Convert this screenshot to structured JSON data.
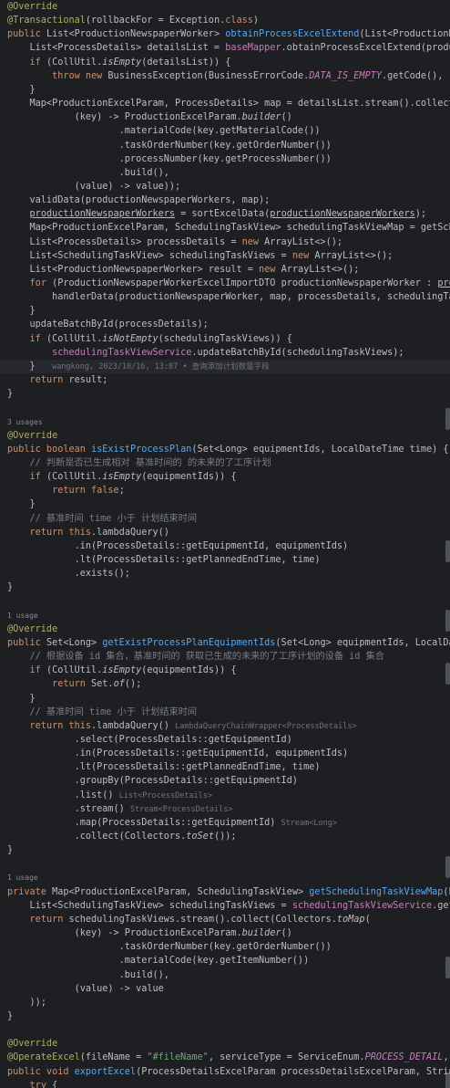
{
  "theme": {
    "background": "#1e1f22",
    "current_line": "#26282e",
    "colors": {
      "t": "#bcbec4",
      "k": "#cf8e6d",
      "a": "#b3ae60",
      "f": "#56a8f5",
      "s": "#6aab73",
      "c": "#7a7e85",
      "i": "#c77dbb",
      "h": "#6f737a",
      "u": "#868a91",
      "fy": "#56a8f5"
    }
  },
  "lines": [
    {
      "small": false,
      "tokens": [
        [
          "a",
          "@Override"
        ]
      ]
    },
    {
      "small": false,
      "tokens": [
        [
          "a",
          "@Transactional"
        ],
        [
          "t",
          "(rollbackFor = Exception."
        ],
        [
          "k",
          "class"
        ],
        [
          "t",
          ")"
        ]
      ]
    },
    {
      "small": false,
      "tokens": [
        [
          "k",
          "public "
        ],
        [
          "t",
          "List<ProductionNewspaperWorker> "
        ],
        [
          "fy",
          "obtainProcessExcelExtend"
        ],
        [
          "t",
          "(List<ProductionNewspaperWorke"
        ]
      ]
    },
    {
      "small": false,
      "tokens": [
        [
          "t",
          "    List<ProcessDetails> detailsList = "
        ],
        [
          "i",
          "baseMapper"
        ],
        [
          "t",
          ".obtainProcessExcelExtend(productionNewspape"
        ]
      ]
    },
    {
      "small": false,
      "tokens": [
        [
          "t",
          "    "
        ],
        [
          "k",
          "if "
        ],
        [
          "t",
          "(CollUtil."
        ],
        [
          "it",
          "isEmpty"
        ],
        [
          "t",
          "(detailsList)) {"
        ]
      ]
    },
    {
      "small": false,
      "tokens": [
        [
          "t",
          "        "
        ],
        [
          "k",
          "throw new "
        ],
        [
          "t",
          "BusinessException(BusinessErrorCode."
        ],
        [
          "ip",
          "DATA_IS_EMPTY"
        ],
        [
          "t",
          ".getCode(), "
        ],
        [
          "s",
          "\"导入的报工数据查"
        ]
      ]
    },
    {
      "small": false,
      "tokens": [
        [
          "t",
          "    }"
        ]
      ]
    },
    {
      "small": false,
      "tokens": [
        [
          "t",
          "    Map<ProductionExcelParam, ProcessDetails> map = detailsList.stream().collect(Collectors."
        ]
      ]
    },
    {
      "small": false,
      "tokens": [
        [
          "t",
          "            (key) -> ProductionExcelParam."
        ],
        [
          "it",
          "builder"
        ],
        [
          "t",
          "()"
        ]
      ]
    },
    {
      "small": false,
      "tokens": [
        [
          "t",
          "                    .materialCode(key.getMaterialCode())"
        ]
      ]
    },
    {
      "small": false,
      "tokens": [
        [
          "t",
          "                    .taskOrderNumber(key.getOrderNumber())"
        ]
      ]
    },
    {
      "small": false,
      "tokens": [
        [
          "t",
          "                    .processNumber(key.getProcessNumber())"
        ]
      ]
    },
    {
      "small": false,
      "tokens": [
        [
          "t",
          "                    .build(),"
        ]
      ]
    },
    {
      "small": false,
      "tokens": [
        [
          "t",
          "            (value) -> value));"
        ]
      ]
    },
    {
      "small": false,
      "tokens": [
        [
          "t",
          "    validData(productionNewspaperWorkers, map);"
        ]
      ]
    },
    {
      "small": false,
      "tokens": [
        [
          "t",
          "    "
        ],
        [
          "tu",
          "productionNewspaperWorkers"
        ],
        [
          "t",
          " = sortExcelData("
        ],
        [
          "tu",
          "productionNewspaperWorkers"
        ],
        [
          "t",
          ");"
        ]
      ]
    },
    {
      "small": false,
      "tokens": [
        [
          "t",
          "    Map<ProductionExcelParam, SchedulingTaskView> schedulingTaskViewMap = getSchedulingTaskVi"
        ]
      ]
    },
    {
      "small": false,
      "tokens": [
        [
          "t",
          "    List<ProcessDetails> processDetails = "
        ],
        [
          "k",
          "new "
        ],
        [
          "t",
          "ArrayList<>();"
        ]
      ]
    },
    {
      "small": false,
      "tokens": [
        [
          "t",
          "    List<SchedulingTaskView> schedulingTaskViews = "
        ],
        [
          "k",
          "new "
        ],
        [
          "t",
          "ArrayList<>();"
        ]
      ]
    },
    {
      "small": false,
      "tokens": [
        [
          "t",
          "    List<ProductionNewspaperWorker> result = "
        ],
        [
          "k",
          "new "
        ],
        [
          "t",
          "ArrayList<>();"
        ]
      ]
    },
    {
      "small": false,
      "tokens": [
        [
          "t",
          "    "
        ],
        [
          "k",
          "for "
        ],
        [
          "t",
          "(ProductionNewspaperWorkerExcelImportDTO productionNewspaperWorker : "
        ],
        [
          "tu",
          "productionNewspa"
        ]
      ]
    },
    {
      "small": false,
      "tokens": [
        [
          "t",
          "        handlerData(productionNewspaperWorker, map, processDetails, schedulingTaskViewMap, sc"
        ]
      ]
    },
    {
      "small": false,
      "tokens": [
        [
          "t",
          "    }"
        ]
      ]
    },
    {
      "small": false,
      "tokens": [
        [
          "t",
          "    updateBatchById(processDetails);"
        ]
      ]
    },
    {
      "small": false,
      "tokens": [
        [
          "t",
          "    "
        ],
        [
          "k",
          "if "
        ],
        [
          "t",
          "(CollUtil."
        ],
        [
          "it",
          "isNotEmpty"
        ],
        [
          "t",
          "(schedulingTaskViews)) {"
        ]
      ]
    },
    {
      "small": false,
      "tokens": [
        [
          "t",
          "        "
        ],
        [
          "i",
          "schedulingTaskViewService"
        ],
        [
          "t",
          ".updateBatchById(schedulingTaskViews);"
        ]
      ]
    },
    {
      "small": false,
      "hl": true,
      "tokens": [
        [
          "t",
          "    }   "
        ],
        [
          "h",
          "wangkong, 2023/10/16, 13:07 • 查询添加计划数量字段"
        ]
      ]
    },
    {
      "small": false,
      "tokens": [
        [
          "t",
          "    "
        ],
        [
          "k",
          "return "
        ],
        [
          "t",
          "result;"
        ]
      ]
    },
    {
      "small": false,
      "tokens": [
        [
          "t",
          "}"
        ]
      ]
    },
    {
      "small": false,
      "tokens": []
    },
    {
      "small": true,
      "tokens": [
        [
          "u",
          "3 usages"
        ]
      ]
    },
    {
      "small": false,
      "tokens": [
        [
          "a",
          "@Override"
        ]
      ]
    },
    {
      "small": false,
      "tokens": [
        [
          "k",
          "public boolean "
        ],
        [
          "fy",
          "isExistProcessPlan"
        ],
        [
          "t",
          "(Set<Long> equipmentIds, LocalDateTime time) {"
        ]
      ]
    },
    {
      "small": false,
      "tokens": [
        [
          "c",
          "    // 判断是否已生成相对 基准时间的 的未来的了工序计划"
        ]
      ]
    },
    {
      "small": false,
      "tokens": [
        [
          "t",
          "    "
        ],
        [
          "k",
          "if "
        ],
        [
          "t",
          "(CollUtil."
        ],
        [
          "it",
          "isEmpty"
        ],
        [
          "t",
          "(equipmentIds)) {"
        ]
      ]
    },
    {
      "small": false,
      "tokens": [
        [
          "t",
          "        "
        ],
        [
          "k",
          "return false"
        ],
        [
          "t",
          ";"
        ]
      ]
    },
    {
      "small": false,
      "tokens": [
        [
          "t",
          "    }"
        ]
      ]
    },
    {
      "small": false,
      "tokens": [
        [
          "c",
          "    // 基准时间 time 小于 计划结束时间"
        ]
      ]
    },
    {
      "small": false,
      "tokens": [
        [
          "t",
          "    "
        ],
        [
          "k",
          "return this"
        ],
        [
          "t",
          ".lambdaQuery()"
        ]
      ]
    },
    {
      "small": false,
      "tokens": [
        [
          "t",
          "            .in(ProcessDetails::getEquipmentId, equipmentIds)"
        ]
      ]
    },
    {
      "small": false,
      "tokens": [
        [
          "t",
          "            .lt(ProcessDetails::getPlannedEndTime, time)"
        ]
      ]
    },
    {
      "small": false,
      "tokens": [
        [
          "t",
          "            .exists();"
        ]
      ]
    },
    {
      "small": false,
      "tokens": [
        [
          "t",
          "}"
        ]
      ]
    },
    {
      "small": false,
      "tokens": []
    },
    {
      "small": true,
      "tokens": [
        [
          "u",
          "1 usage"
        ]
      ]
    },
    {
      "small": false,
      "tokens": [
        [
          "a",
          "@Override"
        ]
      ]
    },
    {
      "small": false,
      "tokens": [
        [
          "k",
          "public "
        ],
        [
          "t",
          "Set<Long> "
        ],
        [
          "fy",
          "getExistProcessPlanEquipmentIds"
        ],
        [
          "t",
          "(Set<Long> equipmentIds, LocalDateTime time)"
        ]
      ]
    },
    {
      "small": false,
      "tokens": [
        [
          "c",
          "    // 根据设备 id 集合，基准时间的 获取已生成的未来的了工序计划的设备 id 集合"
        ]
      ]
    },
    {
      "small": false,
      "tokens": [
        [
          "t",
          "    "
        ],
        [
          "k",
          "if "
        ],
        [
          "t",
          "(CollUtil."
        ],
        [
          "it",
          "isEmpty"
        ],
        [
          "t",
          "(equipmentIds)) {"
        ]
      ]
    },
    {
      "small": false,
      "tokens": [
        [
          "t",
          "        "
        ],
        [
          "k",
          "return "
        ],
        [
          "t",
          "Set."
        ],
        [
          "it",
          "of"
        ],
        [
          "t",
          "();"
        ]
      ]
    },
    {
      "small": false,
      "tokens": [
        [
          "t",
          "    }"
        ]
      ]
    },
    {
      "small": false,
      "tokens": [
        [
          "c",
          "    // 基准时间 time 小于 计划结束时间"
        ]
      ]
    },
    {
      "small": false,
      "tokens": [
        [
          "t",
          "    "
        ],
        [
          "k",
          "return this"
        ],
        [
          "t",
          ".lambdaQuery() "
        ],
        [
          "h",
          "LambdaQueryChainWrapper<ProcessDetails>"
        ]
      ]
    },
    {
      "small": false,
      "tokens": [
        [
          "t",
          "            .select(ProcessDetails::getEquipmentId)"
        ]
      ]
    },
    {
      "small": false,
      "tokens": [
        [
          "t",
          "            .in(ProcessDetails::getEquipmentId, equipmentIds)"
        ]
      ]
    },
    {
      "small": false,
      "tokens": [
        [
          "t",
          "            .lt(ProcessDetails::getPlannedEndTime, time)"
        ]
      ]
    },
    {
      "small": false,
      "tokens": [
        [
          "t",
          "            .groupBy(ProcessDetails::getEquipmentId)"
        ]
      ]
    },
    {
      "small": false,
      "tokens": [
        [
          "t",
          "            .list() "
        ],
        [
          "h",
          "List<ProcessDetails>"
        ]
      ]
    },
    {
      "small": false,
      "tokens": [
        [
          "t",
          "            .stream() "
        ],
        [
          "h",
          "Stream<ProcessDetails>"
        ]
      ]
    },
    {
      "small": false,
      "tokens": [
        [
          "t",
          "            .map(ProcessDetails::getEquipmentId) "
        ],
        [
          "h",
          "Stream<Long>"
        ]
      ]
    },
    {
      "small": false,
      "tokens": [
        [
          "t",
          "            .collect(Collectors."
        ],
        [
          "it",
          "toSet"
        ],
        [
          "t",
          "());"
        ]
      ]
    },
    {
      "small": false,
      "tokens": [
        [
          "t",
          "}"
        ]
      ]
    },
    {
      "small": false,
      "tokens": []
    },
    {
      "small": true,
      "tokens": [
        [
          "u",
          "1 usage"
        ]
      ]
    },
    {
      "small": false,
      "tokens": [
        [
          "k",
          "private "
        ],
        [
          "t",
          "Map<ProductionExcelParam, SchedulingTaskView> "
        ],
        [
          "fy",
          "getSchedulingTaskViewMap"
        ],
        [
          "t",
          "(List<Productio"
        ]
      ]
    },
    {
      "small": false,
      "tokens": [
        [
          "t",
          "    List<SchedulingTaskView> schedulingTaskViews = "
        ],
        [
          "i",
          "schedulingTaskViewService"
        ],
        [
          "t",
          ".getSchedulingTas"
        ]
      ]
    },
    {
      "small": false,
      "tokens": [
        [
          "t",
          "    "
        ],
        [
          "k",
          "return "
        ],
        [
          "t",
          "schedulingTaskViews.stream().collect(Collectors."
        ],
        [
          "it",
          "toMap"
        ],
        [
          "t",
          "("
        ]
      ]
    },
    {
      "small": false,
      "tokens": [
        [
          "t",
          "            (key) -> ProductionExcelParam."
        ],
        [
          "it",
          "builder"
        ],
        [
          "t",
          "()"
        ]
      ]
    },
    {
      "small": false,
      "tokens": [
        [
          "t",
          "                    .taskOrderNumber(key.getOrderNumber())"
        ]
      ]
    },
    {
      "small": false,
      "tokens": [
        [
          "t",
          "                    .materialCode(key.getItemNumber())"
        ]
      ]
    },
    {
      "small": false,
      "tokens": [
        [
          "t",
          "                    .build(),"
        ]
      ]
    },
    {
      "small": false,
      "tokens": [
        [
          "t",
          "            (value) -> value"
        ]
      ]
    },
    {
      "small": false,
      "tokens": [
        [
          "t",
          "    ));"
        ]
      ]
    },
    {
      "small": false,
      "tokens": [
        [
          "t",
          "}"
        ]
      ]
    },
    {
      "small": false,
      "tokens": []
    },
    {
      "small": false,
      "tokens": [
        [
          "a",
          "@Override"
        ]
      ]
    },
    {
      "small": false,
      "tokens": [
        [
          "a",
          "@OperateExcel"
        ],
        [
          "t",
          "(fileName = "
        ],
        [
          "s",
          "\"#fileName\""
        ],
        [
          "t",
          ", serviceType = ServiceEnum."
        ],
        [
          "ip",
          "PROCESS_DETAIL"
        ],
        [
          "t",
          ", operator = Op"
        ]
      ]
    },
    {
      "small": false,
      "tokens": [
        [
          "k",
          "public void "
        ],
        [
          "fy",
          "exportExcel"
        ],
        [
          "t",
          "(ProcessDetailsExcelParam processDetailsExcelParam, String fileName, H"
        ]
      ]
    },
    {
      "small": false,
      "tokens": [
        [
          "t",
          "    "
        ],
        [
          "k",
          "try "
        ],
        [
          "t",
          "{"
        ]
      ]
    },
    {
      "small": false,
      "tokens": [
        [
          "t",
          "        Page<ProcessDetails> processDetailsPage = lambdaQuery()"
        ]
      ]
    },
    {
      "small": false,
      "tokens": [
        [
          "t",
          "                .in(CollUtil."
        ],
        [
          "it",
          "isNotEmpty"
        ],
        [
          "t",
          "(processDetailsExcelParam.getIds()), ProcessDetails::g"
        ]
      ]
    }
  ]
}
